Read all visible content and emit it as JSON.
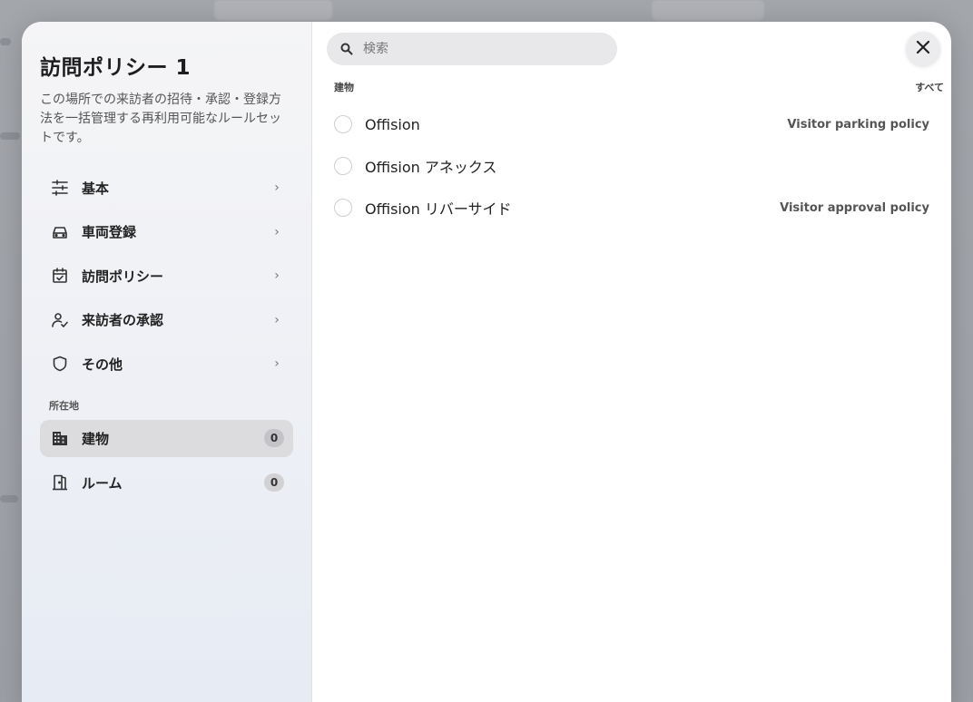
{
  "sidebar": {
    "title": "訪問ポリシー 1",
    "description": "この場所での来訪者の招待・承認・登録方法を一括管理する再利用可能なルールセットです。",
    "nav": [
      {
        "label": "基本",
        "icon": "sliders-icon"
      },
      {
        "label": "車両登録",
        "icon": "car-icon"
      },
      {
        "label": "訪問ポリシー",
        "icon": "calendar-check-icon"
      },
      {
        "label": "来訪者の承認",
        "icon": "user-check-icon"
      },
      {
        "label": "その他",
        "icon": "shield-icon"
      }
    ],
    "section_label": "所在地",
    "locations": [
      {
        "label": "建物",
        "icon": "building-icon",
        "count": "0",
        "active": true
      },
      {
        "label": "ルーム",
        "icon": "door-icon",
        "count": "0",
        "active": false
      }
    ]
  },
  "main": {
    "search": {
      "placeholder": "検索"
    },
    "list_header": {
      "left": "建物",
      "right": "すべて"
    },
    "rows": [
      {
        "name": "Offision",
        "policy": "Visitor parking policy"
      },
      {
        "name": "Offision アネックス",
        "policy": ""
      },
      {
        "name": "Offision リバーサイド",
        "policy": "Visitor approval policy"
      }
    ]
  },
  "colors": {
    "accent": "#1d1d1f",
    "active_item": "#dcdcdf",
    "backdrop": "#9da0a6"
  }
}
